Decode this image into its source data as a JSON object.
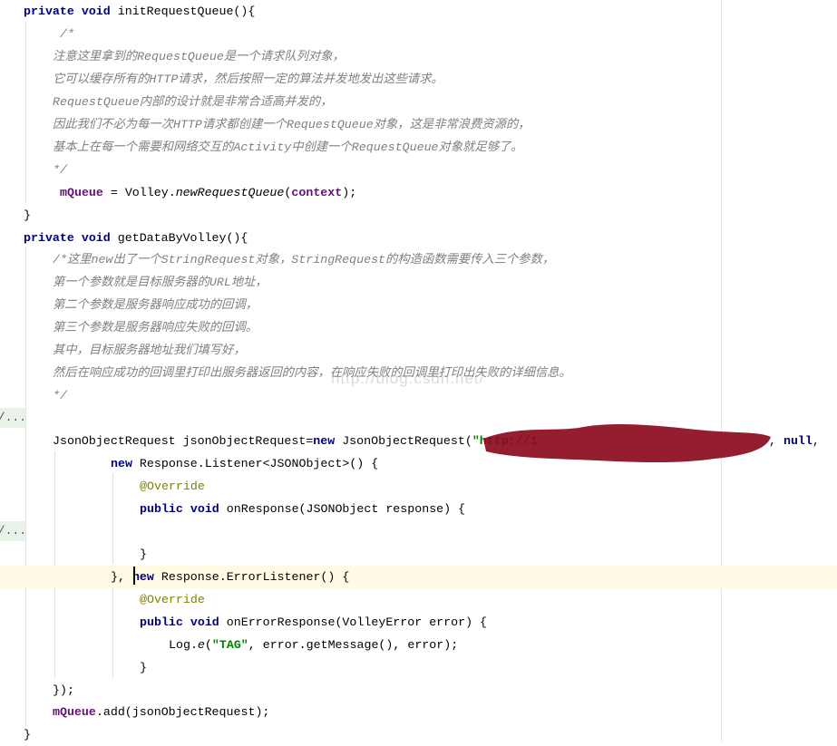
{
  "editor": {
    "watermark": "http://blog.csdn.net/",
    "fold_placeholder": "//...",
    "lines": [
      {
        "indent": 3,
        "tokens": [
          [
            "private ",
            "kw"
          ],
          [
            "void ",
            "kw"
          ],
          [
            "initRequestQueue(){",
            "plain"
          ]
        ]
      },
      {
        "indent": 8,
        "tokens": [
          [
            "/*",
            "cm"
          ]
        ]
      },
      {
        "indent": 7,
        "tokens": [
          [
            "注意这里拿到的RequestQueue是一个请求队列对象，",
            "cm"
          ]
        ]
      },
      {
        "indent": 7,
        "tokens": [
          [
            "它可以缓存所有的HTTP请求，然后按照一定的算法并发地发出这些请求。",
            "cm"
          ]
        ]
      },
      {
        "indent": 7,
        "tokens": [
          [
            "RequestQueue内部的设计就是非常合适高并发的，",
            "cm"
          ]
        ]
      },
      {
        "indent": 7,
        "tokens": [
          [
            "因此我们不必为每一次HTTP请求都创建一个RequestQueue对象，这是非常浪费资源的，",
            "cm"
          ]
        ]
      },
      {
        "indent": 7,
        "tokens": [
          [
            "基本上在每一个需要和网络交互的Activity中创建一个RequestQueue对象就足够了。",
            "cm"
          ]
        ]
      },
      {
        "indent": 7,
        "tokens": [
          [
            "*/",
            "cm"
          ]
        ]
      },
      {
        "indent": 8,
        "tokens": [
          [
            "mQueue",
            "field"
          ],
          [
            " = Volley.",
            "plain"
          ],
          [
            "newRequestQueue",
            "it"
          ],
          [
            "(",
            "plain"
          ],
          [
            "context",
            "field"
          ],
          [
            ");",
            "plain"
          ]
        ]
      },
      {
        "indent": 3,
        "tokens": [
          [
            "}",
            "plain"
          ]
        ]
      },
      {
        "indent": 3,
        "tokens": [
          [
            "private ",
            "kw"
          ],
          [
            "void ",
            "kw"
          ],
          [
            "getDataByVolley(){",
            "plain"
          ]
        ]
      },
      {
        "indent": 7,
        "tokens": [
          [
            "/*这里new出了一个StringRequest对象，StringRequest的构造函数需要传入三个参数，",
            "cm"
          ]
        ]
      },
      {
        "indent": 7,
        "tokens": [
          [
            "第一个参数就是目标服务器的URL地址，",
            "cm"
          ]
        ]
      },
      {
        "indent": 7,
        "tokens": [
          [
            "第二个参数是服务器响应成功的回调，",
            "cm"
          ]
        ]
      },
      {
        "indent": 7,
        "tokens": [
          [
            "第三个参数是服务器响应失败的回调。",
            "cm"
          ]
        ]
      },
      {
        "indent": 7,
        "tokens": [
          [
            "其中，目标服务器地址我们填写好，",
            "cm"
          ]
        ]
      },
      {
        "indent": 7,
        "tokens": [
          [
            "然后在响应成功的回调里打印出服务器返回的内容，在响应失败的回调里打印出失败的详细信息。",
            "cm"
          ]
        ]
      },
      {
        "indent": 7,
        "tokens": [
          [
            "*/",
            "cm"
          ]
        ]
      },
      {
        "indent": 0,
        "fold": true,
        "tokens": []
      },
      {
        "indent": 7,
        "tokens": [
          [
            "JsonObjectRequest jsonObjectRequest=",
            "plain"
          ],
          [
            "new ",
            "kw"
          ],
          [
            "JsonObjectRequest(",
            "plain"
          ],
          [
            "\"http://1                                ",
            "str"
          ],
          [
            ", ",
            "plain"
          ],
          [
            "null",
            "kw"
          ],
          [
            ",",
            "plain"
          ]
        ]
      },
      {
        "indent": 15,
        "tokens": [
          [
            "new ",
            "kw"
          ],
          [
            "Response.Listener<JSONObject>() {",
            "plain"
          ]
        ]
      },
      {
        "indent": 19,
        "tokens": [
          [
            "@Override",
            "ann"
          ]
        ]
      },
      {
        "indent": 19,
        "tokens": [
          [
            "public ",
            "kw"
          ],
          [
            "void ",
            "kw"
          ],
          [
            "onResponse(JSONObject response) {",
            "plain"
          ]
        ]
      },
      {
        "indent": 0,
        "fold": true,
        "tokens": []
      },
      {
        "indent": 19,
        "tokens": [
          [
            "}",
            "plain"
          ]
        ]
      },
      {
        "indent": 15,
        "caret": true,
        "tokens": [
          [
            "}, ",
            "plain"
          ],
          [
            "new ",
            "kw"
          ],
          [
            "Response.ErrorListener() {",
            "plain"
          ]
        ]
      },
      {
        "indent": 19,
        "tokens": [
          [
            "@Override",
            "ann"
          ]
        ]
      },
      {
        "indent": 19,
        "tokens": [
          [
            "public ",
            "kw"
          ],
          [
            "void ",
            "kw"
          ],
          [
            "onErrorResponse(VolleyError error) {",
            "plain"
          ]
        ]
      },
      {
        "indent": 23,
        "tokens": [
          [
            "Log.",
            "plain"
          ],
          [
            "e",
            "it"
          ],
          [
            "(",
            "plain"
          ],
          [
            "\"TAG\"",
            "str"
          ],
          [
            ", error.getMessage(), error);",
            "plain"
          ]
        ]
      },
      {
        "indent": 19,
        "tokens": [
          [
            "}",
            "plain"
          ]
        ]
      },
      {
        "indent": 7,
        "tokens": [
          [
            "});",
            "plain"
          ]
        ]
      },
      {
        "indent": 7,
        "tokens": [
          [
            "mQueue",
            "field"
          ],
          [
            ".add(jsonObjectRequest);",
            "plain"
          ]
        ]
      },
      {
        "indent": 3,
        "tokens": [
          [
            "}",
            "plain"
          ]
        ]
      }
    ]
  }
}
